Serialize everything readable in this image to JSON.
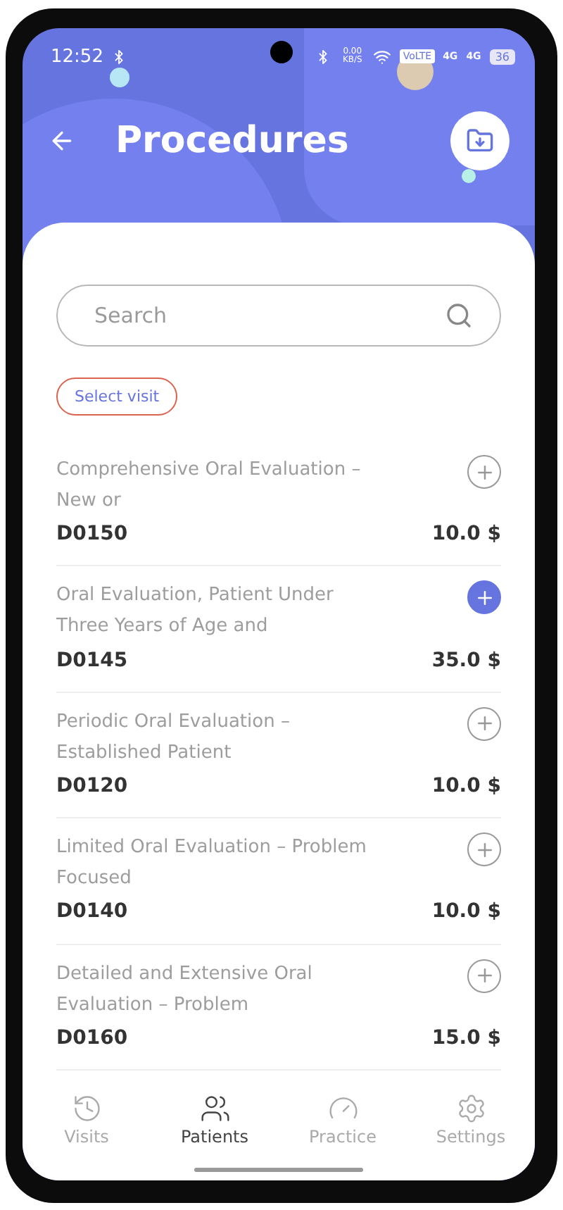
{
  "status_bar": {
    "time": "12:52",
    "speed": "0.00 KB/S",
    "volte": "VoLTE",
    "network_1": "4G",
    "network_2": "4G",
    "battery": "36"
  },
  "header": {
    "title": "Procedures"
  },
  "search": {
    "placeholder": "Search"
  },
  "visit_button": {
    "label": "Select visit"
  },
  "procedures": [
    {
      "title": "Comprehensive Oral Evaluation – New or",
      "code": "D0150",
      "price": "10.0 $",
      "selected": false
    },
    {
      "title": "Oral Evaluation, Patient Under Three Years of Age and",
      "code": "D0145",
      "price": "35.0 $",
      "selected": true
    },
    {
      "title": "Periodic Oral Evaluation – Established Patient",
      "code": "D0120",
      "price": "10.0 $",
      "selected": false
    },
    {
      "title": "Limited Oral Evaluation – Problem Focused",
      "code": "D0140",
      "price": "10.0 $",
      "selected": false
    },
    {
      "title": "Detailed and Extensive Oral Evaluation – Problem",
      "code": "D0160",
      "price": "15.0 $",
      "selected": false
    }
  ],
  "nav": [
    {
      "label": "Visits",
      "selected": false
    },
    {
      "label": "Patients",
      "selected": true
    },
    {
      "label": "Practice",
      "selected": false
    },
    {
      "label": "Settings",
      "selected": false
    }
  ]
}
